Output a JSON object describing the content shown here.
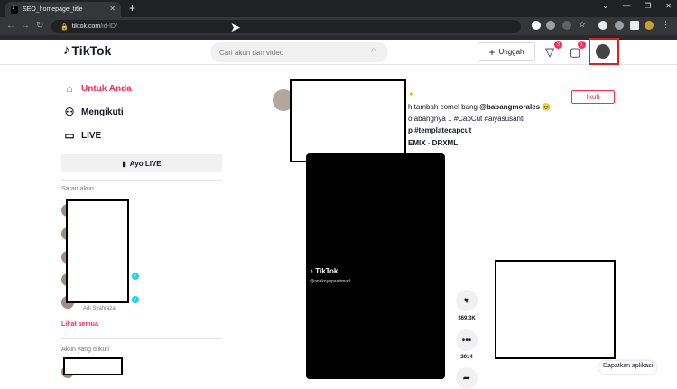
{
  "browser": {
    "tab_title": "SEO_homepage_title",
    "url_host": "tiktok.com",
    "url_path": "/id-ID/"
  },
  "header": {
    "logo_text": "TikTok",
    "search_placeholder": "Cari akun dan video",
    "upload_label": "Unggah",
    "inbox_badge": "3",
    "messages_badge": "1"
  },
  "sidebar": {
    "nav": [
      {
        "label": "Untuk Anda",
        "icon": "home-icon"
      },
      {
        "label": "Mengikuti",
        "icon": "users-icon"
      },
      {
        "label": "LIVE",
        "icon": "live-icon"
      }
    ],
    "live_button": "Ayo LIVE",
    "suggested_title": "Saran akun",
    "suggested_name": "Adi Syahraza",
    "see_all": "Lihat semua",
    "following_title": "Akun yang diikuti"
  },
  "post": {
    "caption_line1_text": "h tambah comel bang ",
    "caption_line1_mention": "@babangmorales",
    "caption_line1_emoji": "😊",
    "caption_line2": "o abangnya .. #CapCut #aiyasusanti",
    "caption_line3": "p #templatecapcut",
    "music": "EMIX - DRXML",
    "follow_label": "Ikuti",
    "watermark": "TikTok",
    "watermark_user": "@anaknyapaahmad",
    "likes": "369.3K",
    "comments": "2014"
  },
  "footer": {
    "get_app": "Dapatkan aplikasi"
  },
  "colors": {
    "brand": "#fe2c55",
    "highlight": "#e11d1d"
  }
}
